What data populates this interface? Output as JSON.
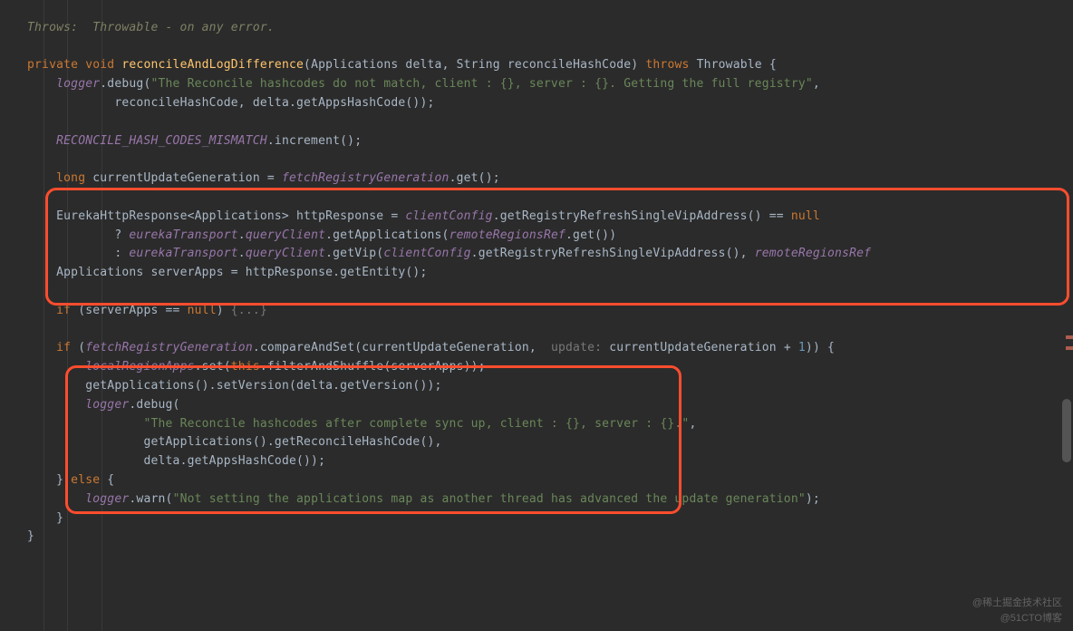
{
  "doc": {
    "line1": "Throws:  Throwable - on any error."
  },
  "sig": {
    "kw_private": "private",
    "kw_void": "void",
    "method": "reconcileAndLogDifference",
    "p1_type": "Applications",
    "p1_name": "delta",
    "p2_type": "String",
    "p2_name": "reconcileHashCode",
    "kw_throws": "throws",
    "throws_type": "Throwable"
  },
  "l2": {
    "logger": "logger",
    "debug": ".debug(",
    "str": "\"The Reconcile hashcodes do not match, client : {}, server : {}. Getting the full registry\"",
    "comma": ","
  },
  "l3": {
    "a": "reconcileHashCode,",
    "b": " delta.getAppsHashCode());"
  },
  "l5": {
    "const": "RECONCILE_HASH_CODES_MISMATCH",
    "rest": ".increment();"
  },
  "l7": {
    "kw_long": "long",
    "var": " currentUpdateGeneration = ",
    "field": "fetchRegistryGeneration",
    "rest": ".get();"
  },
  "l9": {
    "a": "EurekaHttpResponse<Applications> httpResponse = ",
    "field": "clientConfig",
    "b": ".getRegistryRefreshSingleVipAddress() == ",
    "kw_null": "null"
  },
  "l10": {
    "q": "? ",
    "f1": "eurekaTransport",
    "d1": ".",
    "f2": "queryClient",
    "rest": ".getApplications(",
    "f3": "remoteRegionsRef",
    "end": ".get())"
  },
  "l11": {
    "q": ": ",
    "f1": "eurekaTransport",
    "d1": ".",
    "f2": "queryClient",
    "mid": ".getVip(",
    "f3": "clientConfig",
    "mid2": ".getRegistryRefreshSingleVipAddress(), ",
    "f4": "remoteRegionsRef"
  },
  "l12": {
    "txt": "Applications serverApps = httpResponse.getEntity();"
  },
  "l14": {
    "kw_if": "if",
    "cond": " (serverApps == ",
    "kw_null": "null",
    "close": ") ",
    "fold": "{...}"
  },
  "l16": {
    "kw_if": "if",
    "open": " (",
    "field": "fetchRegistryGeneration",
    "mid": ".compareAndSet(currentUpdateGeneration, ",
    "hint": " update: ",
    "arg": "currentUpdateGeneration + ",
    "num": "1",
    "close": ")) {"
  },
  "l17": {
    "field": "localRegionApps",
    "a": ".set(",
    "kw_this": "this",
    "b": ".filterAndShuffle(serverApps));"
  },
  "l18": {
    "txt": "getApplications().setVersion(delta.getVersion());"
  },
  "l19": {
    "logger": "logger",
    "rest": ".debug("
  },
  "l20": {
    "str": "\"The Reconcile hashcodes after complete sync up, client : {}, server : {}.\"",
    "end": ","
  },
  "l21": {
    "txt": "getApplications().getReconcileHashCode(),"
  },
  "l22": {
    "txt": "delta.getAppsHashCode());"
  },
  "l23": {
    "a": "} ",
    "kw_else": "else",
    "b": " {"
  },
  "l24": {
    "logger": "logger",
    "warn": ".warn(",
    "str": "\"Not setting the applications map as another thread has advanced the update generation\"",
    "end": ");"
  },
  "l25": {
    "txt": "}"
  },
  "l26": {
    "txt": "}"
  },
  "watermarks": {
    "top": "@稀土掘金技术社区",
    "bottom": "@51CTO博客"
  }
}
